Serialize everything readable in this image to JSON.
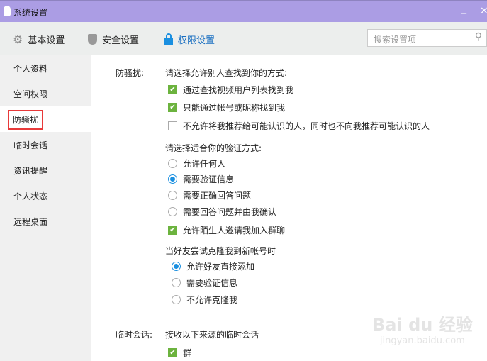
{
  "window": {
    "title": "系统设置",
    "minimize": "_",
    "close": "×"
  },
  "toolbar": {
    "tabs": [
      {
        "label": "基本设置",
        "icon": "gear-icon"
      },
      {
        "label": "安全设置",
        "icon": "shield-icon"
      },
      {
        "label": "权限设置",
        "icon": "lock-icon",
        "active": true
      }
    ],
    "search_placeholder": "搜索设置项"
  },
  "sidebar": {
    "items": [
      "个人资料",
      "空间权限",
      "防骚扰",
      "临时会话",
      "资讯提醒",
      "个人状态",
      "远程桌面"
    ],
    "selected": "防骚扰"
  },
  "content": {
    "section_label": "防骚扰:",
    "find_prompt": "请选择允许别人查找到你的方式:",
    "find_options": [
      {
        "label": "通过查找视频用户列表找到我",
        "checked": true
      },
      {
        "label": "只能通过帐号或昵称找到我",
        "checked": true
      },
      {
        "label": "不允许将我推荐给可能认识的人，同时也不向我推荐可能认识的人",
        "checked": false
      }
    ],
    "verify_prompt": "请选择适合你的验证方式:",
    "verify_options": [
      {
        "label": "允许任何人",
        "selected": false
      },
      {
        "label": "需要验证信息",
        "selected": true
      },
      {
        "label": "需要正确回答问题",
        "selected": false
      },
      {
        "label": "需要回答问题并由我确认",
        "selected": false
      }
    ],
    "group_invite": {
      "label": "允许陌生人邀请我加入群聊",
      "checked": true
    },
    "clone_prompt": "当好友尝试克隆我到新帐号时",
    "clone_options": [
      {
        "label": "允许好友直接添加",
        "selected": true
      },
      {
        "label": "需要验证信息",
        "selected": false
      },
      {
        "label": "不允许克隆我",
        "selected": false
      }
    ],
    "temp_label": "临时会话:",
    "temp_prompt": "接收以下来源的临时会话",
    "temp_options": [
      {
        "label": "群",
        "checked": true
      }
    ]
  },
  "watermark": {
    "brand": "Bai du 经验",
    "url": "jingyan.baidu.com"
  }
}
